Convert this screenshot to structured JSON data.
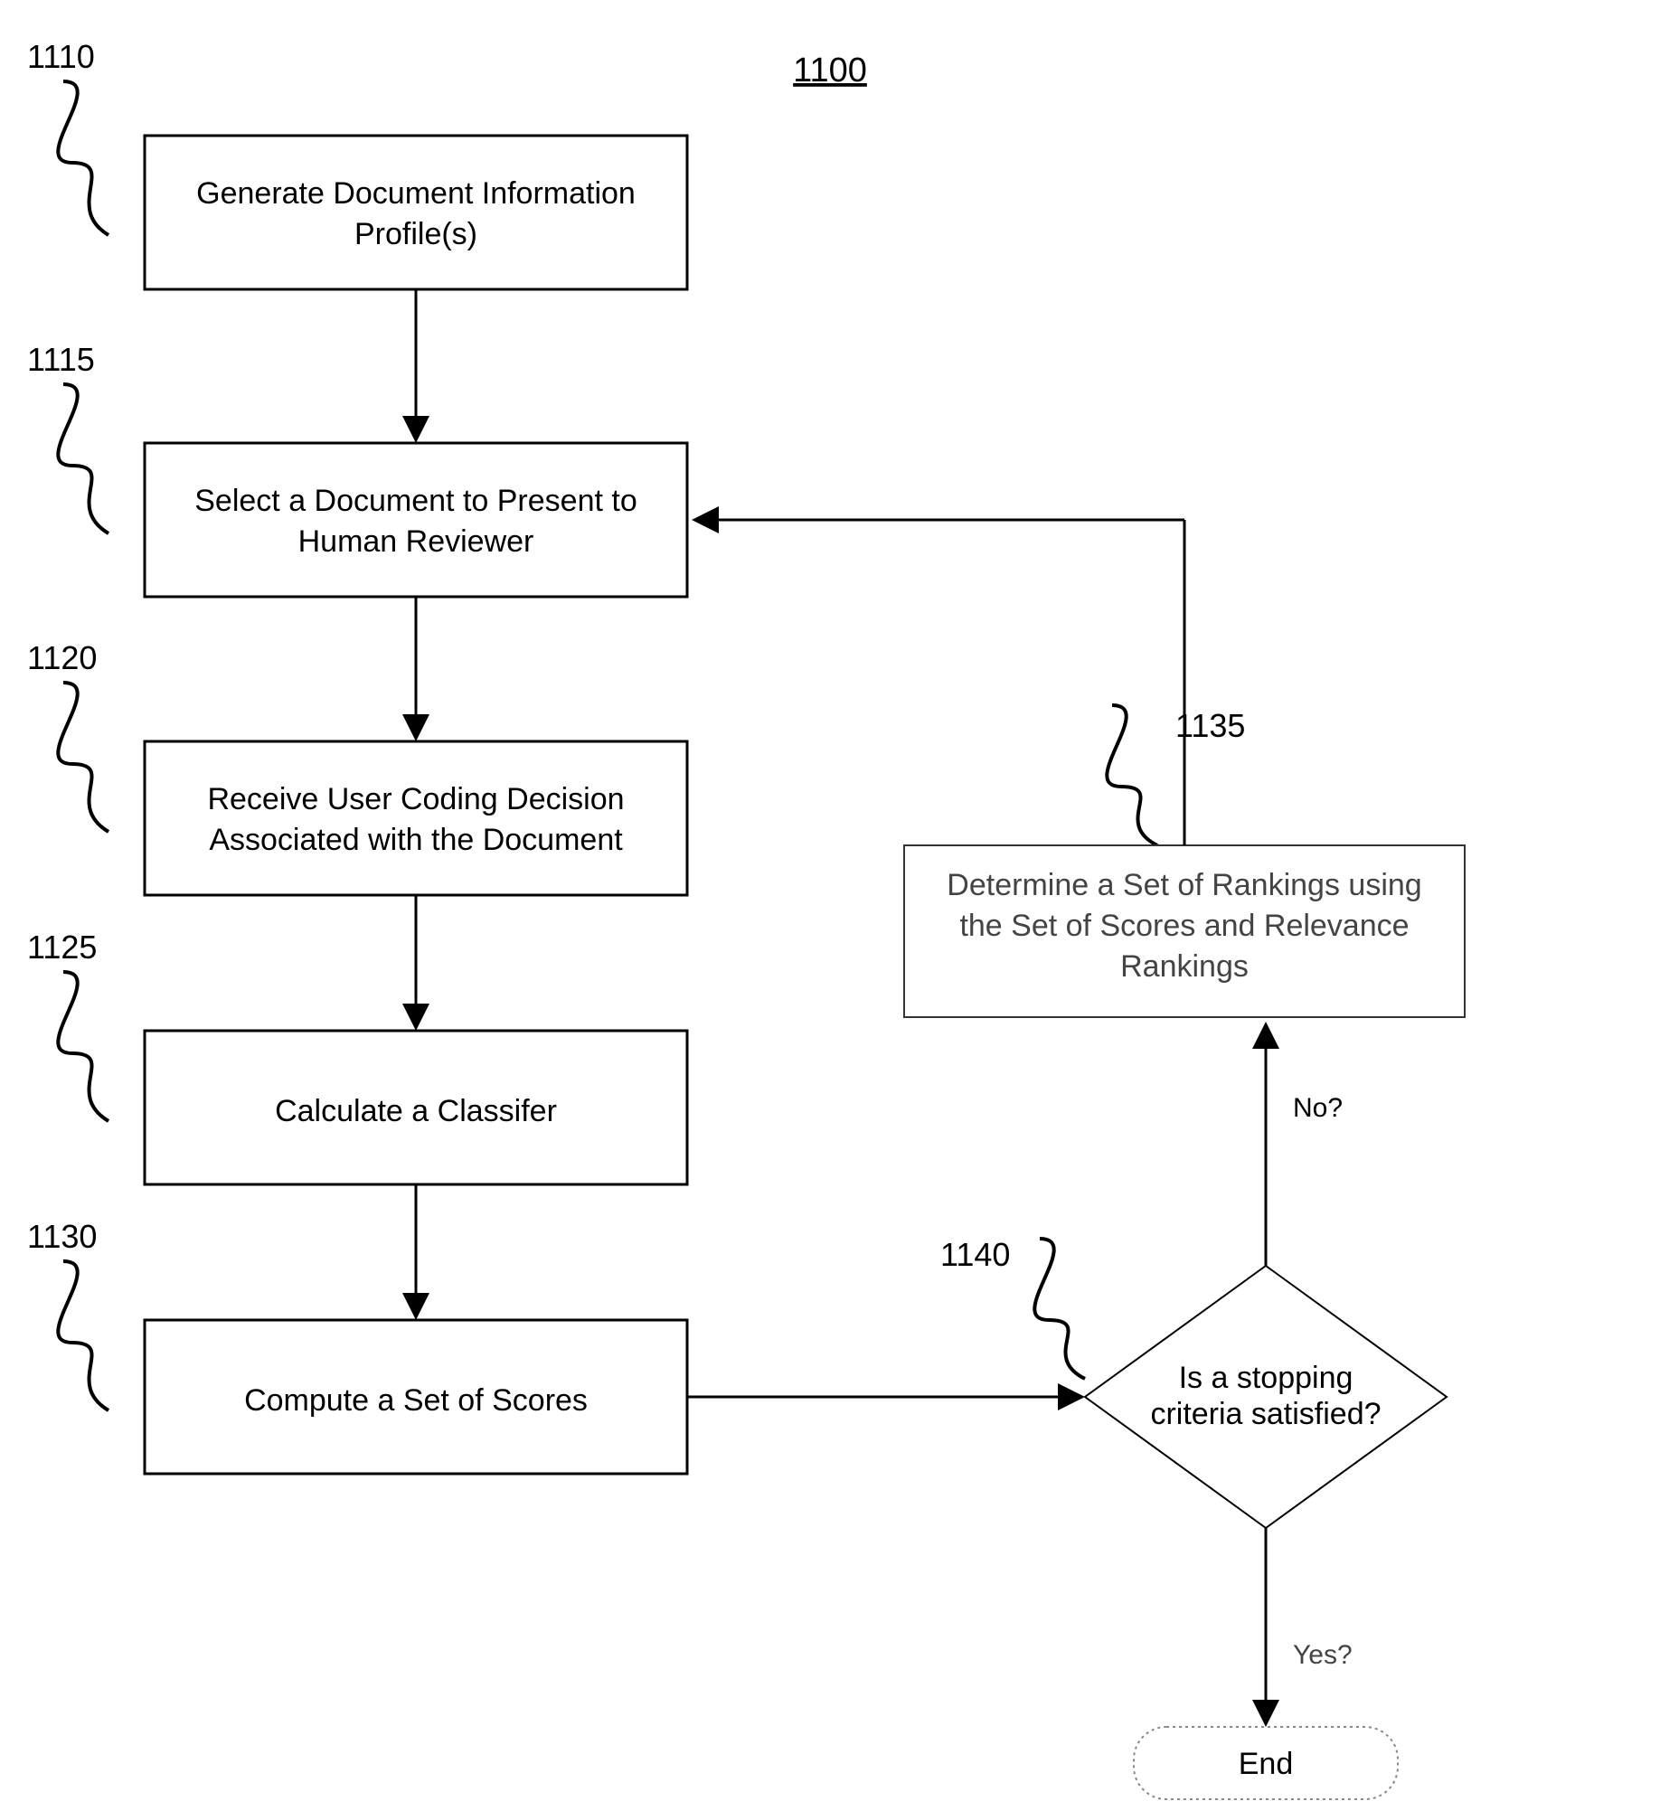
{
  "title": "1100",
  "tags": {
    "t1110": "1110",
    "t1115": "1115",
    "t1120": "1120",
    "t1125": "1125",
    "t1130": "1130",
    "t1135": "1135",
    "t1140": "1140"
  },
  "boxes": {
    "b1110": {
      "l1": "Generate Document Information",
      "l2": "Profile(s)"
    },
    "b1115": {
      "l1": "Select a Document to Present to",
      "l2": "Human Reviewer"
    },
    "b1120": {
      "l1": "Receive User Coding Decision",
      "l2": "Associated with the Document"
    },
    "b1125": {
      "l1": "Calculate a Classifer"
    },
    "b1130": {
      "l1": "Compute a Set of Scores"
    },
    "b1135": {
      "l1": "Determine a Set of Rankings using",
      "l2": "the Set of Scores and Relevance",
      "l3": "Rankings"
    }
  },
  "decision": {
    "l1": "Is a stopping",
    "l2": "criteria satisfied?"
  },
  "labels": {
    "no": "No?",
    "yes": "Yes?"
  },
  "end": "End"
}
